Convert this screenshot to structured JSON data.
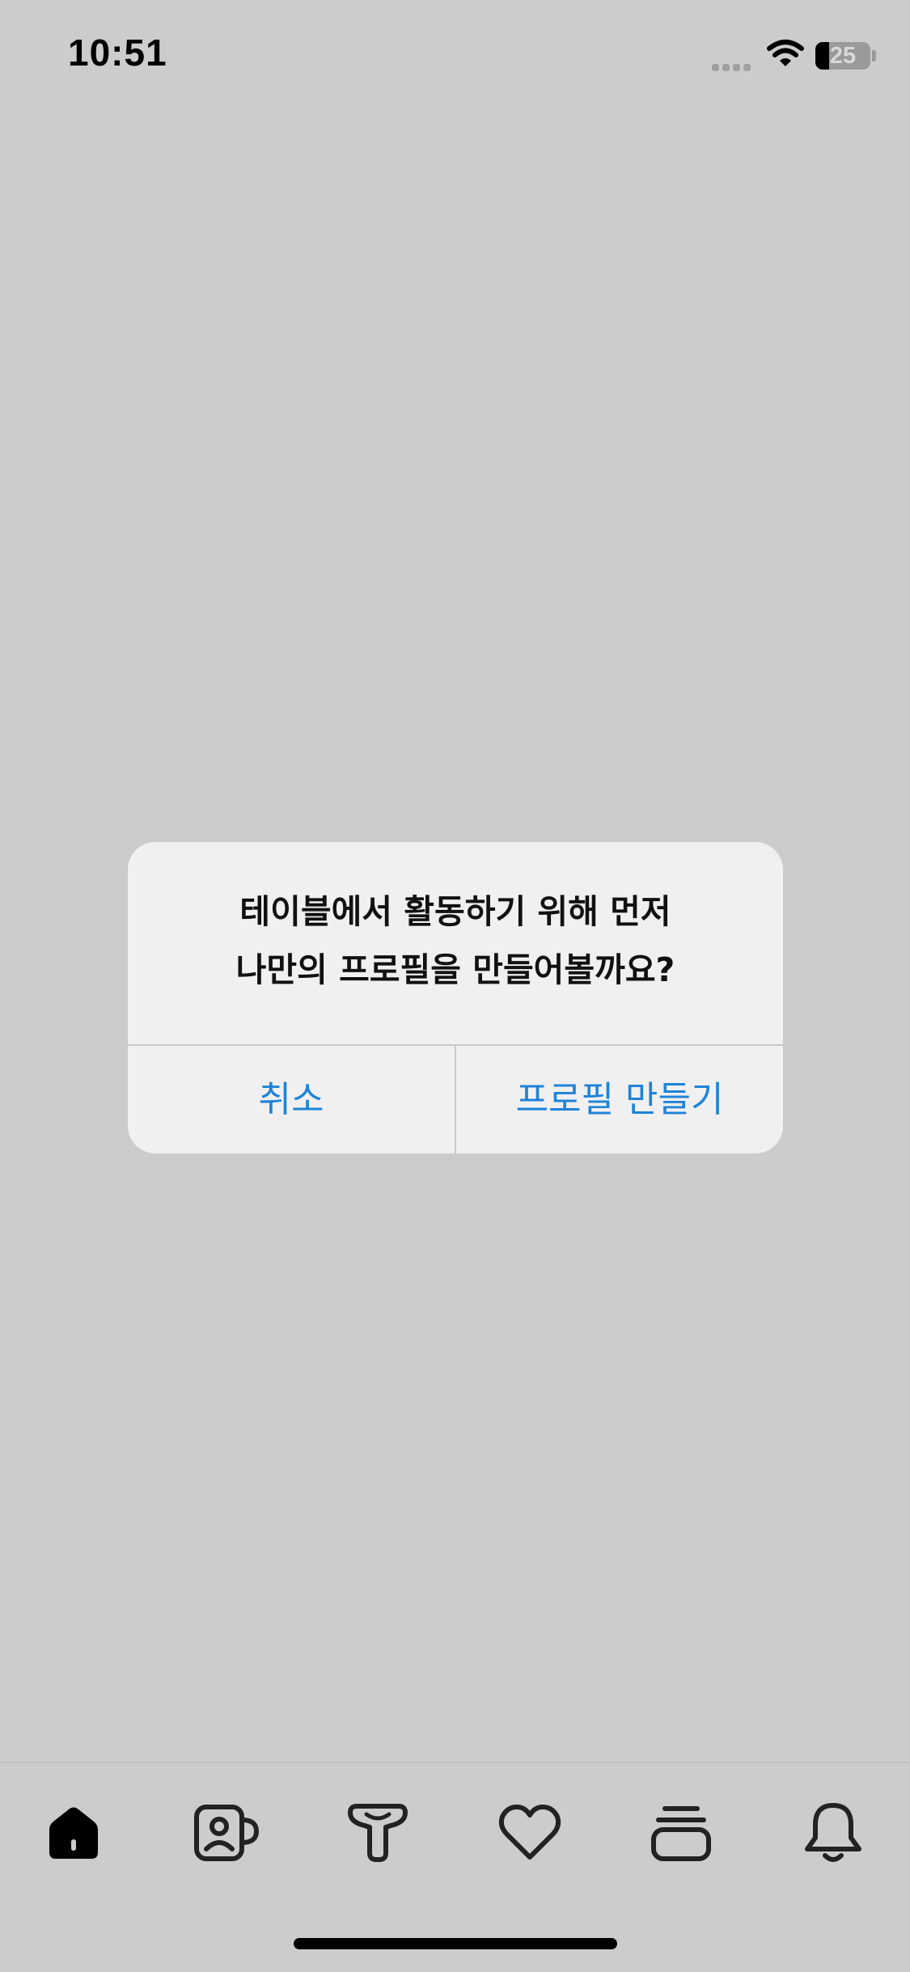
{
  "status_bar": {
    "time": "10:51",
    "battery_level": "25"
  },
  "alert": {
    "message_line1": "테이블에서 활동하기 위해 먼저",
    "message_line2": "나만의 프로필을 만들어볼까요?",
    "cancel_label": "취소",
    "confirm_label": "프로필 만들기"
  },
  "tab_bar": {
    "items": [
      {
        "icon": "home-icon",
        "active": true
      },
      {
        "icon": "profile-mug-icon",
        "active": false
      },
      {
        "icon": "table-icon",
        "active": false
      },
      {
        "icon": "heart-icon",
        "active": false
      },
      {
        "icon": "stack-icon",
        "active": false
      },
      {
        "icon": "bell-icon",
        "active": false
      }
    ]
  },
  "colors": {
    "background": "#cccccc",
    "alert_background": "#f0f0f0",
    "accent": "#1f83d8"
  }
}
